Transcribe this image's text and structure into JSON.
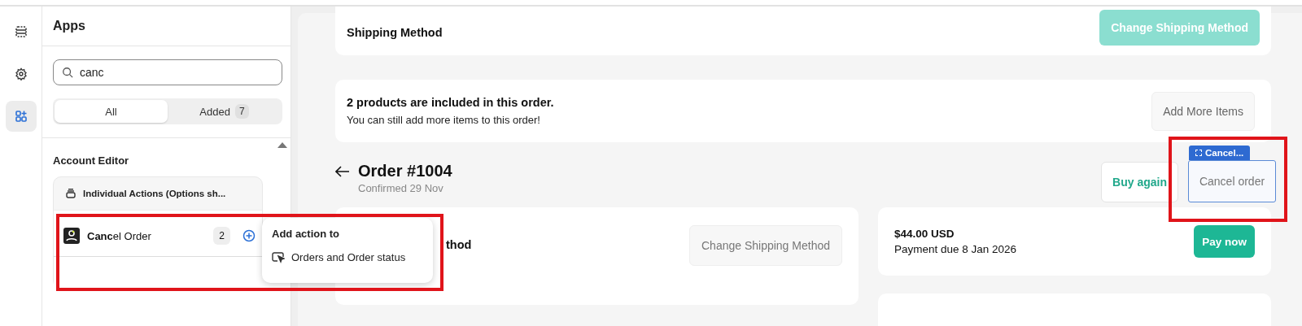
{
  "rail": [
    {
      "kind": "blocks",
      "selected": false
    },
    {
      "kind": "gear",
      "selected": false
    },
    {
      "kind": "apps",
      "selected": true
    }
  ],
  "sidebar": {
    "title": "Apps",
    "search": {
      "value": "canc"
    },
    "filters": [
      {
        "label": "All",
        "selected": true
      },
      {
        "label": "Added",
        "count": "7",
        "selected": false
      }
    ],
    "section": "Account Editor",
    "group": {
      "title": "Individual Actions (Options sh...",
      "items": [
        {
          "label": "**Canc**el Order",
          "count": "2"
        }
      ]
    }
  },
  "popup": {
    "title": "Add action to",
    "options": [
      {
        "label": "Orders and Order status"
      }
    ]
  },
  "shipping_card": {
    "title": "Shipping Method",
    "button": {
      "label": "Change Shipping Method",
      "disabled": true
    }
  },
  "items_card": {
    "title": "2 products are included in this order.",
    "text": "You can still add more items to this order!",
    "button": "Add More Items"
  },
  "order": {
    "title": "Order #1004",
    "subtitle": "Confirmed 29 Nov",
    "buttons": [
      {
        "label": "Buy again",
        "kind": "secondary"
      },
      {
        "label": "Cancel order",
        "kind": "picked",
        "tag": "Cancel..."
      }
    ]
  },
  "shipping_card_2": {
    "title": "thod",
    "button": {
      "label": "Change Shipping Method",
      "disabled": false
    }
  },
  "payment_card": {
    "amount": "$44.00 USD",
    "due": "Payment due 8 Jan 2026",
    "button": "Pay now"
  }
}
